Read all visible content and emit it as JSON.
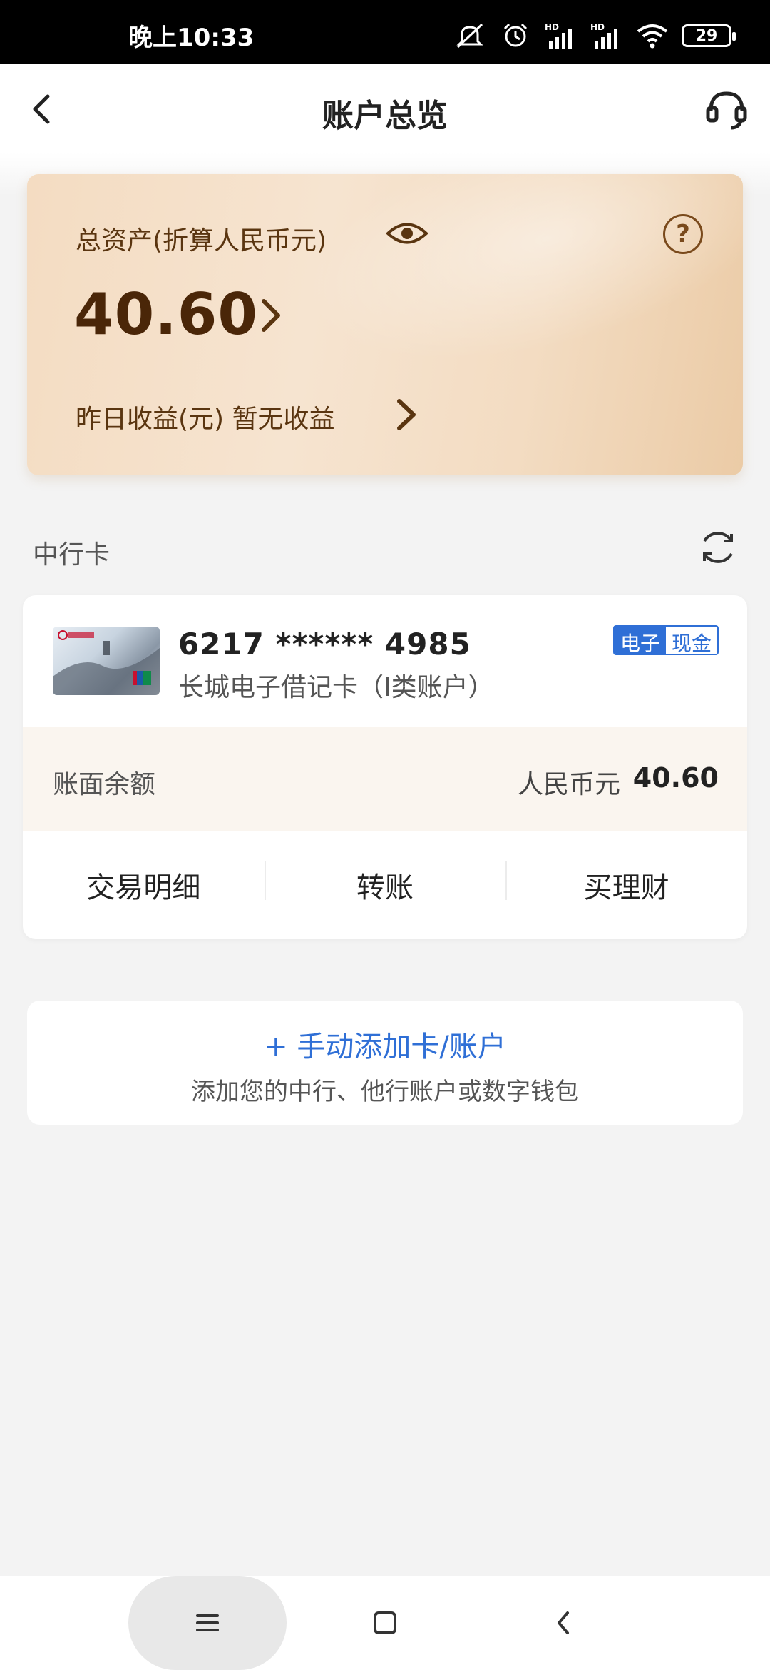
{
  "status_bar": {
    "time": "晚上10:33",
    "icons": [
      "mute-bell-icon",
      "alarm-icon",
      "signal-hd-icon",
      "signal-hd-icon",
      "wifi-icon",
      "battery-icon"
    ],
    "battery": "29"
  },
  "header": {
    "title": "账户总览",
    "back_icon": "chevron-left-icon",
    "service_icon": "headset-icon"
  },
  "asset_card": {
    "label": "总资产(折算人民币元)",
    "amount": "40.60",
    "yield_label": "昨日收益(元) 暂无收益",
    "help": "?",
    "accent": "#4a2608"
  },
  "section": {
    "title": "中行卡"
  },
  "account": {
    "card_number": "6217 ****** 4985",
    "card_type": "长城电子借记卡（Ⅰ类账户）",
    "badge_left": "电子",
    "badge_right": "现金",
    "balance_label": "账面余额",
    "currency": "人民币元",
    "balance": "40.60",
    "actions": [
      "交易明细",
      "转账",
      "买理财"
    ]
  },
  "add_account": {
    "title": "+ 手动添加卡/账户",
    "subtitle": "添加您的中行、他行账户或数字钱包",
    "accent": "#2f6fd6"
  },
  "nav_bar": {
    "icons": [
      "menu-icon",
      "home-square-icon",
      "back-icon"
    ]
  }
}
